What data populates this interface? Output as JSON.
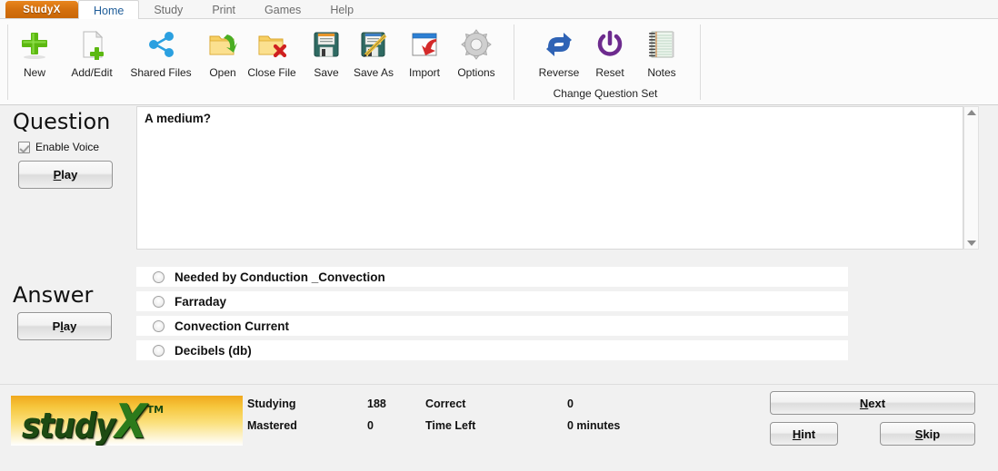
{
  "titlebar": {
    "brand": "StudyX",
    "tabs": [
      {
        "label": "Home",
        "active": true
      },
      {
        "label": "Study",
        "active": false
      },
      {
        "label": "Print",
        "active": false
      },
      {
        "label": "Games",
        "active": false
      },
      {
        "label": "Help",
        "active": false
      }
    ]
  },
  "ribbon": {
    "items": [
      {
        "label": "New",
        "icon": "plus-icon"
      },
      {
        "label": "Add/Edit",
        "icon": "document-add-icon"
      },
      {
        "label": "Shared Files",
        "icon": "share-nodes-icon"
      },
      {
        "label": "Open",
        "icon": "folder-open-icon"
      },
      {
        "label": "Close File",
        "icon": "folder-close-icon"
      },
      {
        "label": "Save",
        "icon": "floppy-disk-icon"
      },
      {
        "label": "Save As",
        "icon": "floppy-disk-pencil-icon"
      },
      {
        "label": "Import",
        "icon": "import-window-arrow-icon"
      },
      {
        "label": "Options",
        "icon": "gear-icon"
      },
      {
        "label": "Reverse",
        "icon": "reverse-arrows-icon"
      },
      {
        "label": "Reset",
        "icon": "power-icon"
      },
      {
        "label": "Notes",
        "icon": "notepad-icon"
      }
    ],
    "group_label": "Change Question Set"
  },
  "question_panel": {
    "title": "Question",
    "enable_voice_label": "Enable Voice",
    "enable_voice_checked": true,
    "play_label_pre": "P",
    "play_label_accel": "",
    "play_button": "Play"
  },
  "answer_panel": {
    "title": "Answer",
    "play_button": "Play"
  },
  "question": {
    "text": "A medium?"
  },
  "answers": [
    {
      "num": "1",
      "text": "Needed by Conduction _Convection",
      "selected": false
    },
    {
      "num": "2",
      "text": "Farraday",
      "selected": false
    },
    {
      "num": "3",
      "text": "Convection Current",
      "selected": false
    },
    {
      "num": "4",
      "text": "Decibels (db)",
      "selected": false
    }
  ],
  "logo": {
    "text": "study",
    "x": "X",
    "tm": "TM"
  },
  "status": {
    "studying_label": "Studying",
    "studying_value": "188",
    "mastered_label": "Mastered",
    "mastered_value": "0",
    "correct_label": "Correct",
    "correct_value": "0",
    "time_left_label": "Time Left",
    "time_left_value": "0 minutes"
  },
  "actions": {
    "next": "Next",
    "hint": "Hint",
    "skip": "Skip"
  },
  "colors": {
    "brand_orange": "#d4700e",
    "active_tab_text": "#1f5d99",
    "logo_green": "#1d4a12",
    "window_bg": "#f1f1f1"
  }
}
